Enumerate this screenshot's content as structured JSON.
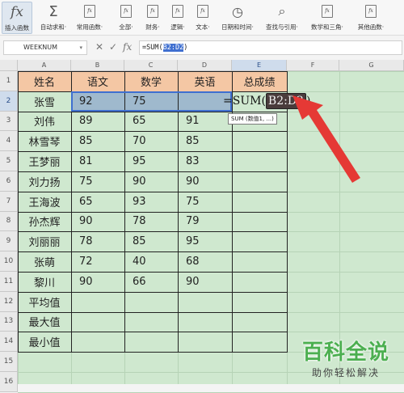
{
  "ribbon": {
    "buttons": [
      {
        "label": "插入函数",
        "icon": "fx-icon"
      },
      {
        "label": "自动求和·",
        "icon": "sigma-icon"
      },
      {
        "label": "常用函数·",
        "icon": "function-icon"
      },
      {
        "label": "全部·",
        "icon": "function-icon"
      },
      {
        "label": "财务·",
        "icon": "function-icon"
      },
      {
        "label": "逻辑·",
        "icon": "function-icon"
      },
      {
        "label": "文本·",
        "icon": "function-icon"
      },
      {
        "label": "日期和时间·",
        "icon": "clock-icon"
      },
      {
        "label": "查找与引用·",
        "icon": "search-icon"
      },
      {
        "label": "数学和三角·",
        "icon": "function-icon"
      },
      {
        "label": "其他函数·",
        "icon": "function-icon"
      }
    ]
  },
  "formula_bar": {
    "name_box": "WEEKNUM",
    "formula_prefix": "=SUM(",
    "formula_range": "B2:D2",
    "formula_suffix": ")"
  },
  "columns": [
    "A",
    "B",
    "C",
    "D",
    "E",
    "F",
    "G"
  ],
  "rows": [
    "1",
    "2",
    "3",
    "4",
    "5",
    "6",
    "7",
    "8",
    "9",
    "10",
    "11",
    "12",
    "13",
    "14",
    "15",
    "16"
  ],
  "headers": [
    "姓名",
    "语文",
    "数学",
    "英语",
    "总成绩"
  ],
  "students": [
    {
      "name": "张雪",
      "chinese": "92",
      "math": "75",
      "english": ""
    },
    {
      "name": "刘伟",
      "chinese": "89",
      "math": "65",
      "english": "91"
    },
    {
      "name": "林雪琴",
      "chinese": "85",
      "math": "70",
      "english": "85"
    },
    {
      "name": "王梦丽",
      "chinese": "81",
      "math": "95",
      "english": "83"
    },
    {
      "name": "刘力扬",
      "chinese": "75",
      "math": "90",
      "english": "90"
    },
    {
      "name": "王海波",
      "chinese": "65",
      "math": "93",
      "english": "75"
    },
    {
      "name": "孙杰辉",
      "chinese": "90",
      "math": "78",
      "english": "79"
    },
    {
      "name": "刘丽丽",
      "chinese": "78",
      "math": "85",
      "english": "95"
    },
    {
      "name": "张萌",
      "chinese": "72",
      "math": "40",
      "english": "68"
    },
    {
      "name": "黎川",
      "chinese": "90",
      "math": "66",
      "english": "90"
    }
  ],
  "summary_rows": [
    "平均值",
    "最大值",
    "最小值"
  ],
  "edit_cell": {
    "prefix": "=SUM(",
    "range": "B2:D2",
    "suffix": ")",
    "tooltip": "SUM (数值1, ...)"
  },
  "watermark": {
    "line1": "百科全说",
    "line2": "助你轻松解决"
  },
  "colors": {
    "header_fill": "#f4c7a4",
    "sheet_bg": "#cfe8cf",
    "selection": "#9fb9cd",
    "arrow": "#e53935"
  }
}
